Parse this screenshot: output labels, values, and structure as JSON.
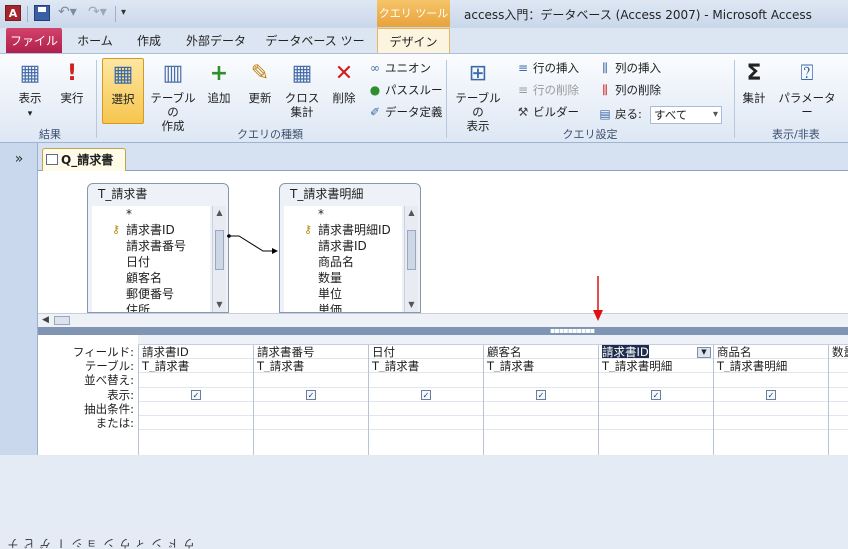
{
  "title_bar": {
    "app_icon": "A",
    "context_tab_header": "クエリ ツール",
    "window_title": "access入門：データベース (Access 2007)  -  Microsoft Access"
  },
  "ribbon_tabs": [
    "ファイル",
    "ホーム",
    "作成",
    "外部データ",
    "データベース ツール",
    "デザイン"
  ],
  "ribbon": {
    "results_group": {
      "label": "結果",
      "view": "表示",
      "run": "実行"
    },
    "query_type_group": {
      "label": "クエリの種類",
      "select": "選択",
      "make_table_line1": "テーブルの",
      "make_table_line2": "作成",
      "append": "追加",
      "update": "更新",
      "crosstab_line1": "クロス",
      "crosstab_line2": "集計",
      "delete": "削除",
      "union": "ユニオン",
      "pass_through": "パススルー",
      "data_definition": "データ定義"
    },
    "query_setup_group": {
      "label": "クエリ設定",
      "show_table_line1": "テーブルの",
      "show_table_line2": "表示",
      "insert_rows": "行の挿入",
      "delete_rows": "行の削除",
      "builder": "ビルダー",
      "insert_columns": "列の挿入",
      "delete_columns": "列の削除",
      "return_label": "戻る:",
      "return_value": "すべて"
    },
    "show_hide_group": {
      "label": "表示/非表",
      "totals": "集計",
      "parameters": "パラメーター"
    }
  },
  "nav_pane": {
    "toggle": "»",
    "label": "ナビゲーション ウィンドウ"
  },
  "document_tab": "Q_請求書",
  "tables": [
    {
      "name": "T_請求書",
      "fields": [
        "*",
        "請求書ID",
        "請求書番号",
        "日付",
        "顧客名",
        "郵便番号",
        "住所"
      ],
      "key_field": "請求書ID"
    },
    {
      "name": "T_請求書明細",
      "fields": [
        "*",
        "請求書明細ID",
        "請求書ID",
        "商品名",
        "数量",
        "単位",
        "単価"
      ],
      "key_field": "請求書明細ID"
    }
  ],
  "grid": {
    "row_labels": [
      "フィールド:",
      "テーブル:",
      "並べ替え:",
      "表示:",
      "抽出条件:",
      "または:"
    ],
    "columns": [
      {
        "field": "請求書ID",
        "table": "T_請求書",
        "show": true
      },
      {
        "field": "請求書番号",
        "table": "T_請求書",
        "show": true
      },
      {
        "field": "日付",
        "table": "T_請求書",
        "show": true
      },
      {
        "field": "顧客名",
        "table": "T_請求書",
        "show": true
      },
      {
        "field": "請求書ID",
        "table": "T_請求書明細",
        "show": true,
        "selected": true
      },
      {
        "field": "商品名",
        "table": "T_請求書明細",
        "show": true
      },
      {
        "field": "数量",
        "table": "",
        "show": false
      }
    ]
  },
  "colors": {
    "accent_file_tab": "#b01d4a",
    "context_tab": "#e8a23a",
    "red_arrow": "#e01010"
  }
}
